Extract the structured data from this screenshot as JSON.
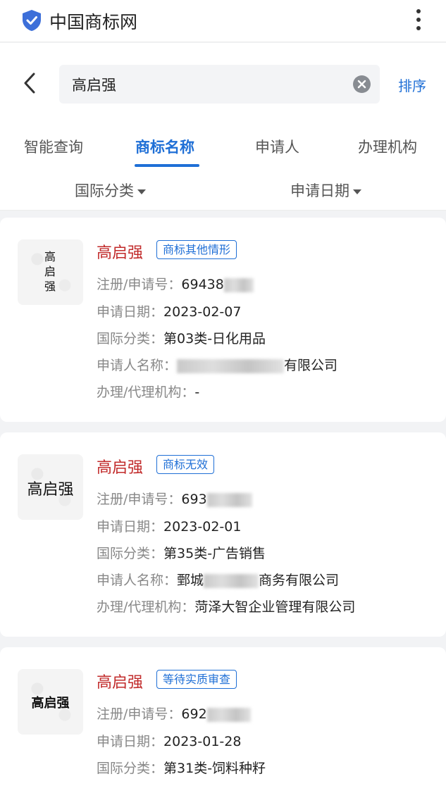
{
  "header": {
    "app_title": "中国商标网",
    "icon": "shield-check-icon",
    "menu_icon": "more-vertical-icon"
  },
  "search": {
    "value": "高启强",
    "sort_label": "排序",
    "clear_icon": "clear-icon",
    "back_icon": "chevron-left-icon"
  },
  "tabs": [
    {
      "label": "智能查询",
      "active": false
    },
    {
      "label": "商标名称",
      "active": true
    },
    {
      "label": "申请人",
      "active": false
    },
    {
      "label": "办理机构",
      "active": false
    }
  ],
  "filters": [
    {
      "label": "国际分类"
    },
    {
      "label": "申请日期"
    }
  ],
  "field_labels": {
    "reg_no": "注册/申请号：",
    "apply_date": "申请日期：",
    "intl_class": "国际分类：",
    "applicant": "申请人名称：",
    "agency": "办理/代理机构："
  },
  "results": [
    {
      "logo_text": "高启强",
      "name": "高启强",
      "status": "商标其他情形",
      "reg_no": "69438",
      "apply_date": "2023-02-07",
      "intl_class": "第03类-日化用品",
      "applicant_suffix": "有限公司",
      "agency": "-"
    },
    {
      "logo_text": "高启强",
      "name": "高启强",
      "status": "商标无效",
      "reg_no": "693",
      "apply_date": "2023-02-01",
      "intl_class": "第35类-广告销售",
      "applicant_prefix": "鄄城",
      "applicant_suffix": "商务有限公司",
      "agency": "菏泽大智企业管理有限公司"
    },
    {
      "logo_text": "高启强",
      "name": "高启强",
      "status": "等待实质审查",
      "reg_no": "692",
      "apply_date": "2023-01-28",
      "intl_class": "第31类-饲料种籽"
    }
  ],
  "colors": {
    "accent": "#1f6fd6",
    "name_red": "#c12a2a",
    "label_grey": "#888888"
  }
}
